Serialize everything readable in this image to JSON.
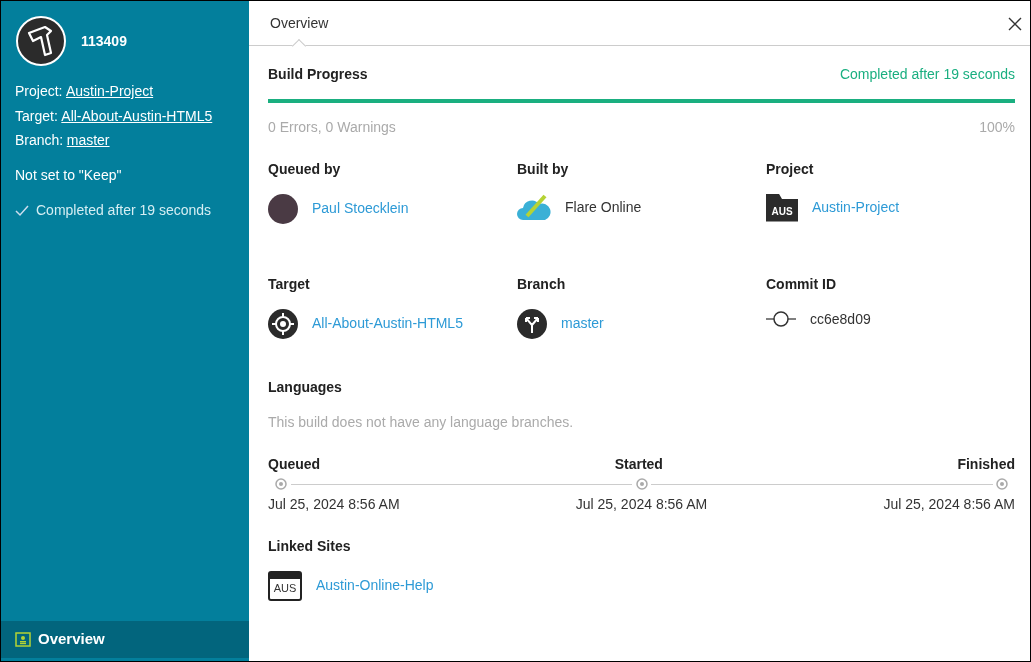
{
  "sidebar": {
    "build_number": "113409",
    "fields": [
      {
        "label": "Project:",
        "value": "Austin-Project"
      },
      {
        "label": "Target:",
        "value": "All-About-Austin-HTML5"
      },
      {
        "label": "Branch:",
        "value": "master"
      }
    ],
    "keep_status": "Not set to \"Keep\"",
    "completion": "Completed after 19 seconds",
    "nav": [
      {
        "label": "Overview",
        "selected": true
      }
    ]
  },
  "tabs": [
    {
      "label": "Overview",
      "selected": true
    }
  ],
  "build_progress": {
    "title": "Build Progress",
    "status": "Completed after 19 seconds",
    "level": 1,
    "issues": "0 Errors, 0 Warnings",
    "percent": "100%"
  },
  "details": [
    {
      "label": "Queued by",
      "kind": "avatar",
      "value": "Paul Stoecklein",
      "link": true
    },
    {
      "label": "Built by",
      "kind": "cloud",
      "value": "Flare Online",
      "link": false
    },
    {
      "label": "Project",
      "kind": "folder",
      "icon_text": "AUS",
      "value": "Austin-Project",
      "link": true
    },
    {
      "label": "Target",
      "kind": "target",
      "value": "All-About-Austin-HTML5",
      "link": true
    },
    {
      "label": "Branch",
      "kind": "branch",
      "value": "master",
      "link": true
    },
    {
      "label": "Commit ID",
      "kind": "commit",
      "value": "cc6e8d09",
      "link": false
    }
  ],
  "languages": {
    "title": "Languages",
    "message": "This build does not have any language branches."
  },
  "timeline": [
    {
      "label": "Queued",
      "time": "Jul 25, 2024 8:56 AM"
    },
    {
      "label": "Started",
      "time": "Jul 25, 2024 8:56 AM"
    },
    {
      "label": "Finished",
      "time": "Jul 25, 2024 8:56 AM"
    }
  ],
  "linked_sites": {
    "title": "Linked Sites",
    "items": [
      {
        "icon_text": "AUS",
        "name": "Austin-Online-Help"
      }
    ]
  }
}
